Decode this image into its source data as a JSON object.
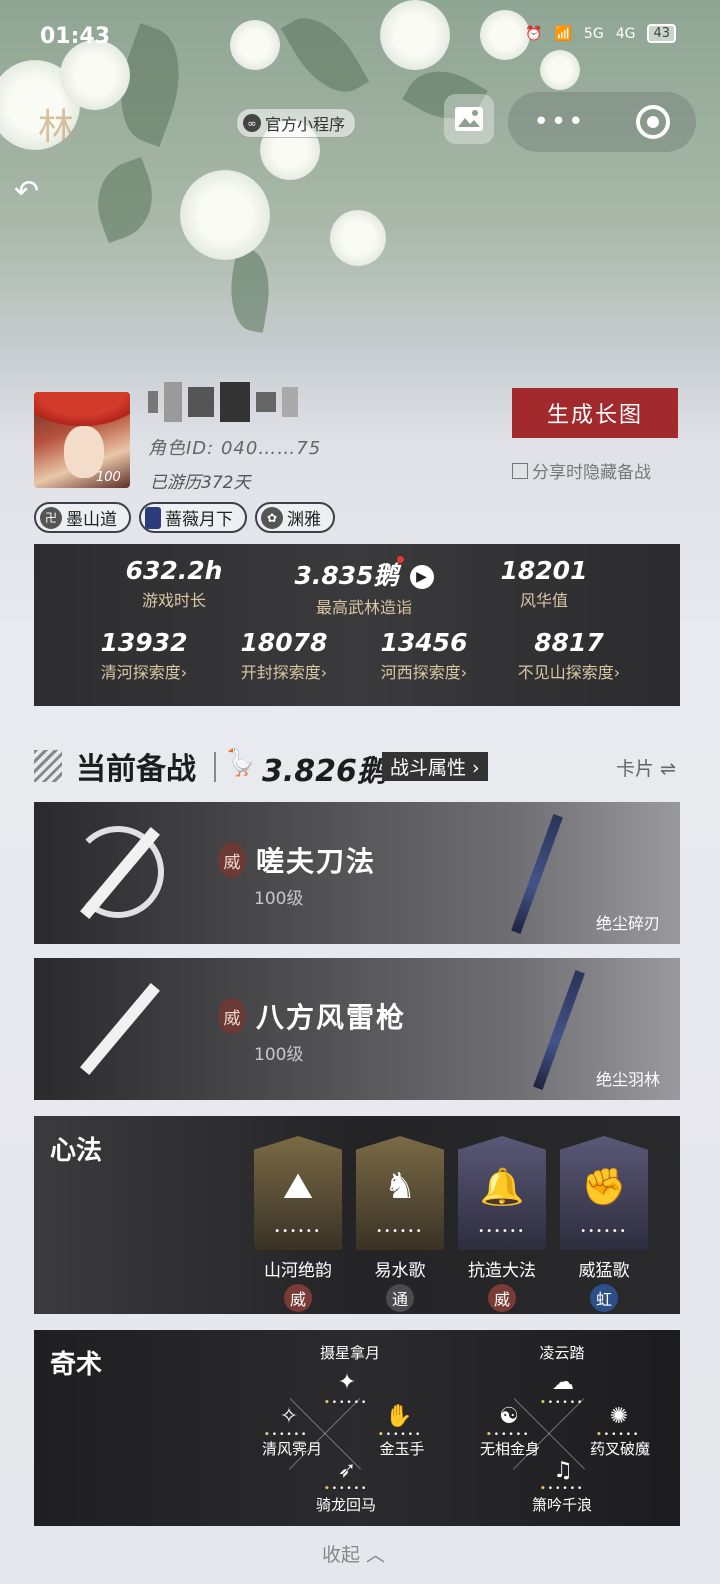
{
  "status_bar": {
    "time": "01:43",
    "network_5g": "5G",
    "network_4g": "4G",
    "battery": "43"
  },
  "header": {
    "logo_text": "林",
    "badge": "官方小程序"
  },
  "profile": {
    "level": "100",
    "role_id": "角色ID: 040……75",
    "days": "已游历372天",
    "generate_button": "生成长图",
    "hide_checkbox_label": "分享时隐藏备战",
    "tags": [
      "墨山道",
      "蔷薇月下",
      "渊雅"
    ]
  },
  "stats": {
    "row1": [
      {
        "value": "632.2h",
        "label": "游戏时长"
      },
      {
        "value": "3.835鹅",
        "label": "最高武林造诣"
      },
      {
        "value": "18201",
        "label": "风华值"
      }
    ],
    "row2": [
      {
        "value": "13932",
        "label": "清河探索度"
      },
      {
        "value": "18078",
        "label": "开封探索度"
      },
      {
        "value": "13456",
        "label": "河西探索度"
      },
      {
        "value": "8817",
        "label": "不见山探索度"
      }
    ]
  },
  "section": {
    "title": "当前备战",
    "power": "3.826鹅",
    "battle_attr": "战斗属性",
    "card_toggle": "卡片"
  },
  "weapons": [
    {
      "type": "威",
      "name": "嗟夫刀法",
      "level": "100级",
      "weapon": "绝尘碎刃"
    },
    {
      "type": "威",
      "name": "八方风雷枪",
      "level": "100级",
      "weapon": "绝尘羽林"
    }
  ],
  "xinfa": {
    "title": "心法",
    "items": [
      {
        "name": "山河绝韵",
        "type": "威",
        "icon": "mountain-icon",
        "color": "#6b5a36",
        "type_color": "#7a3b36"
      },
      {
        "name": "易水歌",
        "type": "通",
        "icon": "horse-icon",
        "color": "#6b5a36",
        "type_color": "#4b4b4d"
      },
      {
        "name": "抗造大法",
        "type": "威",
        "icon": "bell-icon",
        "color": "#4a4866",
        "type_color": "#7a3b36"
      },
      {
        "name": "威猛歌",
        "type": "虹",
        "icon": "fist-icon",
        "color": "#4a4866",
        "type_color": "#2c4f8a"
      }
    ]
  },
  "qishu": {
    "title": "奇术",
    "left_group": [
      "摄星拿月",
      "清风霁月",
      "金玉手",
      "骑龙回马"
    ],
    "right_group": [
      "凌云踏",
      "无相金身",
      "药叉破魔",
      "箫吟千浪"
    ]
  },
  "collapse_label": "收起"
}
